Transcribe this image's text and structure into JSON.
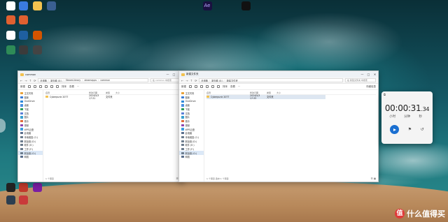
{
  "desktop_icons": [
    {
      "label": "",
      "color": "#ffffff"
    },
    {
      "label": "",
      "color": "#3a7be0"
    },
    {
      "label": "",
      "color": "#f3c24f"
    },
    {
      "label": "",
      "color": "#3a5f91"
    },
    {
      "label": "",
      "color": "#e06030"
    },
    {
      "label": "",
      "color": "#e06030"
    },
    {
      "label": "",
      "color": "#ffffff"
    },
    {
      "label": "",
      "color": "#1e5fa0"
    },
    {
      "label": "",
      "color": "#d35400"
    },
    {
      "label": "",
      "color": "#2e8b57"
    },
    {
      "label": "",
      "color": "#3b3b3b"
    },
    {
      "label": "",
      "color": "#444444"
    },
    {
      "label": "",
      "color": "#222222"
    },
    {
      "label": "",
      "color": "#c0392b"
    },
    {
      "label": "",
      "color": "#7b1fa2"
    },
    {
      "label": "",
      "color": "#2c3e50"
    },
    {
      "label": "",
      "color": "#c93a3a"
    },
    {
      "label": "Ae",
      "color": "#1a1040"
    },
    {
      "label": "",
      "color": "#111111"
    }
  ],
  "window_left": {
    "title": "common",
    "breadcrumbs": [
      "此电脑",
      "新加卷 (E:)",
      "SteamLibrary",
      "steamapps",
      "common"
    ],
    "search_placeholder": "在 common 中搜索",
    "toolbar": {
      "new": "新建",
      "sort": "排序",
      "view": "查看"
    },
    "sidebar": [
      "主文件夹",
      "图库",
      "OneDrive",
      "桌面",
      "下载",
      "文档",
      "图片",
      "音乐",
      "视频",
      "WPS云盘",
      "此电脑",
      "本地磁盘 (C:)",
      "新加卷 (D:)",
      "软件 (E:)",
      "工作 (F:)",
      "新加卷 (G:)",
      "网络"
    ],
    "columns": [
      "名称",
      "修改日期",
      "类型",
      "大小"
    ],
    "rows": [
      {
        "name": "Cyberpunk 2077",
        "date": "2024/5/3 17:31",
        "type": "文件夹",
        "size": ""
      }
    ],
    "status": "1 个项目"
  },
  "window_right": {
    "title": "新建文件夹",
    "breadcrumbs": [
      "此电脑",
      "新加卷 (E:)",
      "新建文件夹"
    ],
    "search_placeholder": "在 新建文件夹 中搜索",
    "toolbar": {
      "new": "新建",
      "sort": "排序",
      "view": "查看",
      "details": "详细信息"
    },
    "sidebar": [
      "主文件夹",
      "图库",
      "OneDrive",
      "桌面",
      "下载",
      "文档",
      "图片",
      "音乐",
      "视频",
      "WPS云盘",
      "此电脑",
      "本地磁盘 (C:)",
      "新加卷 (D:)",
      "软件 (E:)",
      "工作 (F:)",
      "新加卷 (G:)",
      "网络"
    ],
    "columns": [
      "名称",
      "修改日期",
      "类型",
      "大小"
    ],
    "rows": [
      {
        "name": "Cyberpunk 2077",
        "date": "2024/5/3 17:33",
        "type": "文件夹",
        "size": ""
      }
    ],
    "status": "1 个项目 选中 1 个项目"
  },
  "clock": {
    "time_main": "00:00:31",
    "time_frac": ".34",
    "units": [
      "小时",
      "分钟",
      "秒"
    ]
  },
  "watermark": {
    "logo": "值",
    "text": "什么值得买"
  }
}
